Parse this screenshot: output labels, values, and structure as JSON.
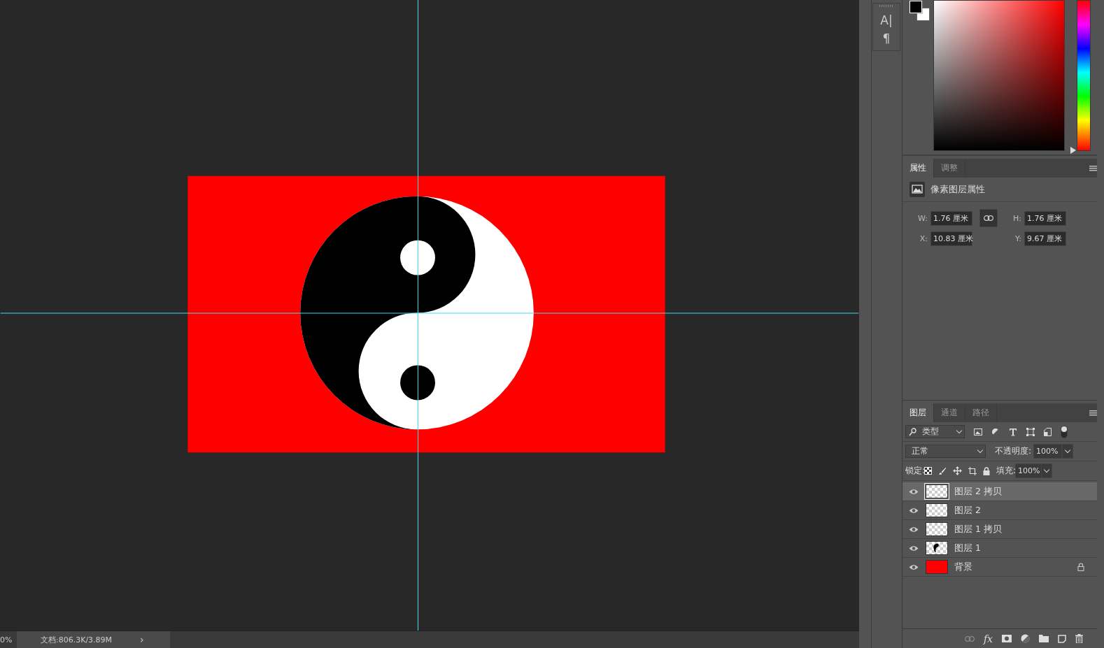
{
  "tool_strip": {
    "glyphs": [
      "A|",
      "¶"
    ]
  },
  "color_picker": {
    "hue": {
      "level": 0
    }
  },
  "properties": {
    "tabs": [
      {
        "label": "属性",
        "selected": true
      },
      {
        "label": "调整",
        "selected": false
      }
    ],
    "heading": "像素图层属性",
    "fields": [
      {
        "label": "W:",
        "value": "1.76 厘米"
      },
      {
        "label": "H:",
        "value": "1.76 厘米"
      },
      {
        "label": "X:",
        "value": "10.83 厘米"
      },
      {
        "label": "Y:",
        "value": "9.67 厘米"
      }
    ]
  },
  "layers_panel": {
    "tabs": [
      {
        "label": "图层",
        "selected": true
      },
      {
        "label": "通道",
        "selected": false
      },
      {
        "label": "路径",
        "selected": false
      }
    ],
    "filter": "类型",
    "blend_mode": "正常",
    "opacity_label": "不透明度:",
    "opacity": "100%",
    "lock_label": "锁定:",
    "fill_label": "填充:",
    "fill": "100%",
    "layers": [
      {
        "name": "图层 2 拷贝",
        "kind": "transparent",
        "selected": true,
        "locked": false
      },
      {
        "name": "图层 2",
        "kind": "transparent",
        "selected": false,
        "locked": false
      },
      {
        "name": "图层 1 拷贝",
        "kind": "transparent",
        "selected": false,
        "locked": false
      },
      {
        "name": "图层 1",
        "kind": "yinyang",
        "selected": false,
        "locked": false
      },
      {
        "name": "背景",
        "kind": "fill",
        "selected": false,
        "locked": true
      }
    ],
    "fx_label": "fx"
  },
  "status_bar": {
    "zoom": "0%",
    "document": "文档:806.3K/3.89M",
    "arrow": "›"
  }
}
